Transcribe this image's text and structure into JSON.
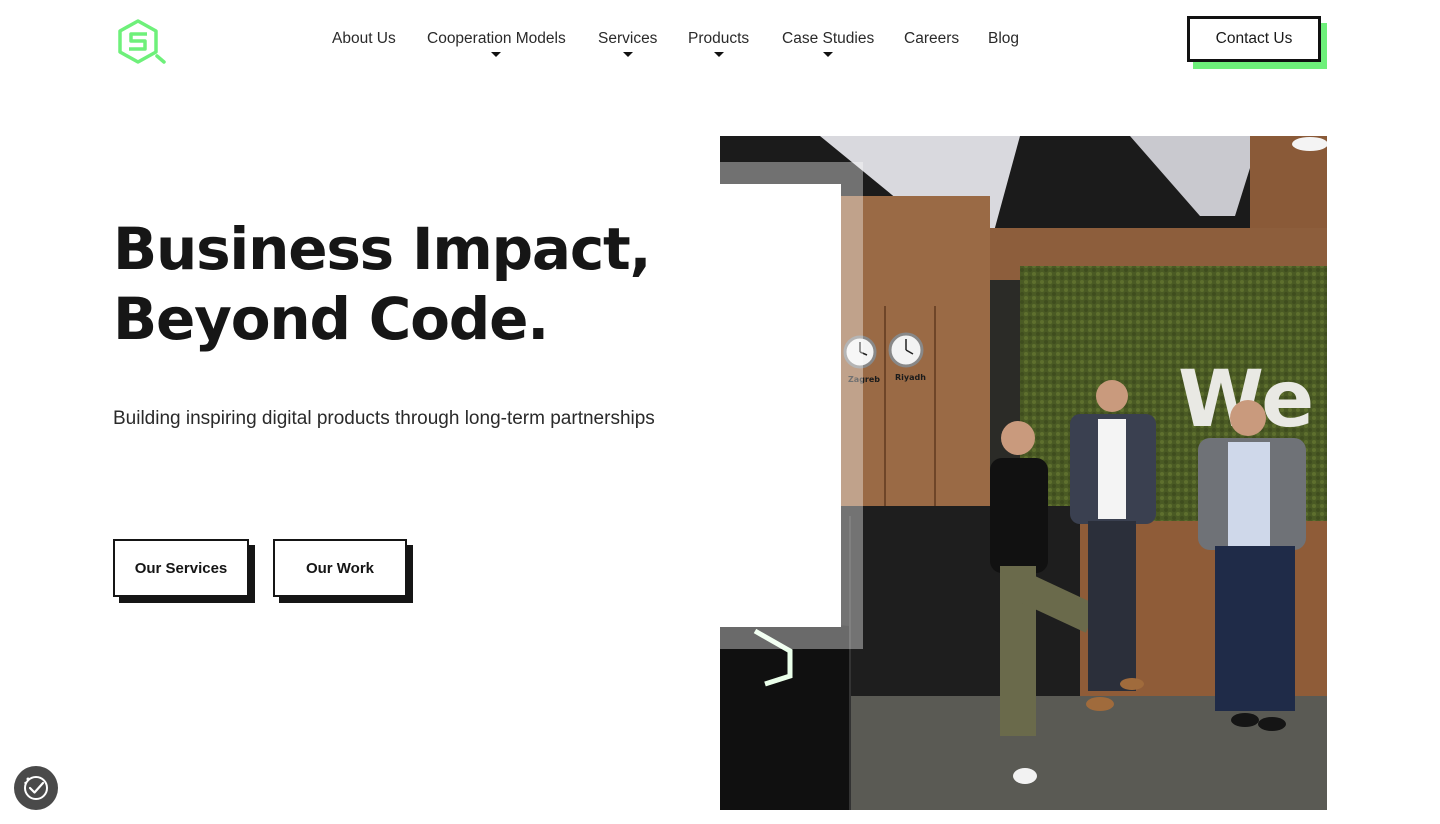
{
  "brand": {
    "accent_color": "#6ef07a",
    "logo_icon": "hexagon-s-logo-icon"
  },
  "nav": {
    "items": [
      {
        "label": "About Us",
        "has_dropdown": false
      },
      {
        "label": "Cooperation Models",
        "has_dropdown": true
      },
      {
        "label": "Services",
        "has_dropdown": true
      },
      {
        "label": "Products",
        "has_dropdown": true
      },
      {
        "label": "Case Studies",
        "has_dropdown": true
      },
      {
        "label": "Careers",
        "has_dropdown": false
      },
      {
        "label": "Blog",
        "has_dropdown": false
      }
    ],
    "contact_label": "Contact Us"
  },
  "hero": {
    "title_line1": "Business Impact,",
    "title_line2": "Beyond Code.",
    "subtitle": "Building inspiring digital products through long-term partnerships",
    "primary_button": "Our Services",
    "secondary_button": "Our Work"
  },
  "photo": {
    "wall_text": "We",
    "clock1_label": "Zagreb",
    "clock2_label": "Riyadh"
  },
  "cookie_badge": {
    "icon": "cookie-settings-check-icon"
  }
}
